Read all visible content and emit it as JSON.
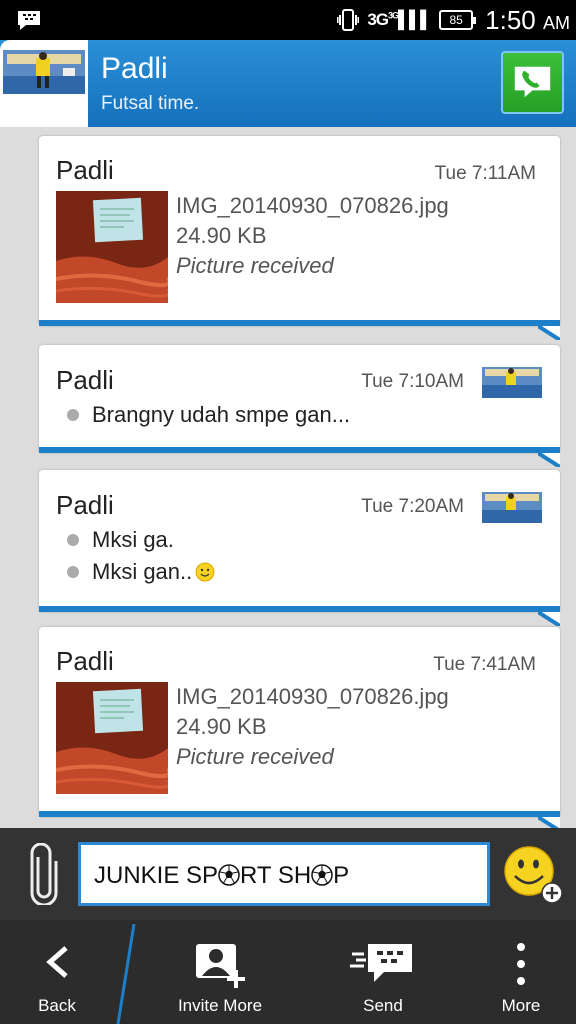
{
  "statusbar": {
    "network": "3G",
    "network_sup": "3G",
    "battery": "85",
    "time": "1:50",
    "ampm": "AM",
    "icons": [
      "bbm-icon",
      "vibrate-icon",
      "signal-icon",
      "battery-icon"
    ]
  },
  "header": {
    "name": "Padli",
    "status": "Futsal time.",
    "call_icon": "phone-icon"
  },
  "messages": [
    {
      "type": "file",
      "sender": "Padli",
      "time": "Tue 7:11AM",
      "filename": "IMG_20140930_070826.jpg",
      "size": "24.90 KB",
      "status": "Picture received"
    },
    {
      "type": "text",
      "sender": "Padli",
      "time": "Tue 7:10AM",
      "lines": [
        "Brangny udah smpe gan..."
      ]
    },
    {
      "type": "text",
      "sender": "Padli",
      "time": "Tue 7:20AM",
      "lines": [
        "Mksi ga.",
        "Mksi gan.."
      ]
    },
    {
      "type": "file",
      "sender": "Padli",
      "time": "Tue 7:41AM",
      "filename": "IMG_20140930_070826.jpg",
      "size": "24.90 KB",
      "status": "Picture received"
    }
  ],
  "composer": {
    "text_a": "JUNKIE SP",
    "text_b": "RT SH",
    "text_c": "P",
    "attach_icon": "paperclip-icon",
    "emoji_icon": "smiley-add-icon"
  },
  "nav": {
    "back": "Back",
    "invite": "Invite More",
    "send": "Send",
    "more": "More"
  },
  "colors": {
    "accent_blue": "#1d7fc8",
    "header_blue": "#2a8fd6",
    "call_green": "#2fb02d"
  }
}
